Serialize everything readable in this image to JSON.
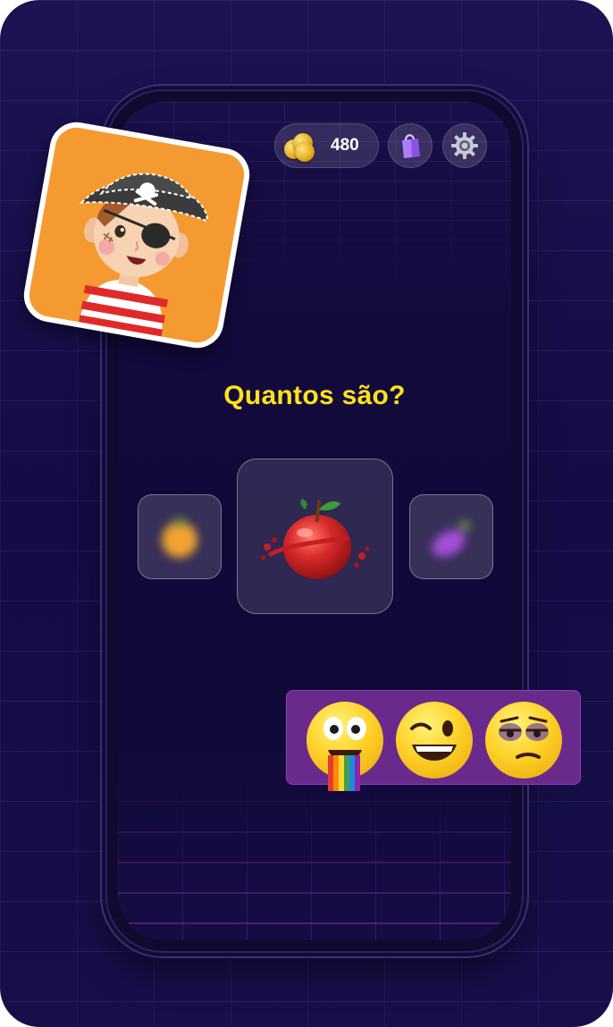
{
  "game": {
    "coins": "480",
    "question": "Quantos são?"
  },
  "icons": {
    "coins": "coin-stack-icon",
    "shop": "shopping-bag-icon",
    "settings": "gear-icon"
  },
  "carousel": {
    "items": [
      {
        "name": "orange",
        "state": "blurred"
      },
      {
        "name": "apple",
        "state": "selected"
      },
      {
        "name": "eggplant",
        "state": "blurred"
      }
    ]
  },
  "decor": {
    "avatar": "pirate-boy",
    "emojis": [
      "rainbow-tongue-emoji",
      "winking-emoji",
      "tired-unamused-emoji"
    ]
  },
  "colors": {
    "background": "#160e48",
    "accent_text": "#ffe21a",
    "avatar_bg": "#f59a31",
    "emoji_panel": "#6a2a8c"
  }
}
